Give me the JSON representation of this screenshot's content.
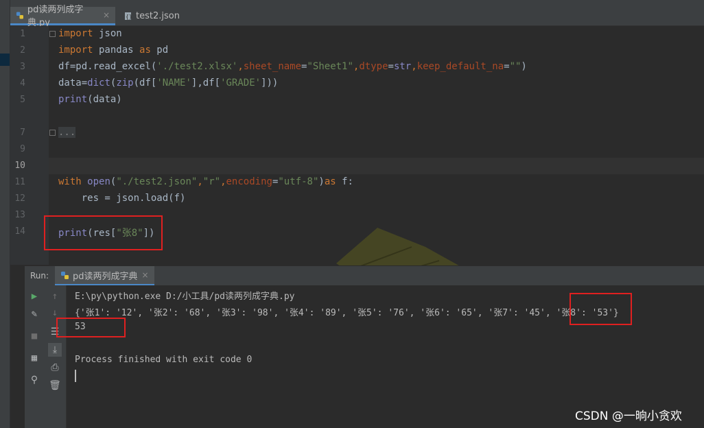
{
  "tabs": [
    {
      "label": "pd读两列成字典.py",
      "close": "×",
      "active": true
    },
    {
      "label": "test2.json",
      "active": false
    }
  ],
  "editor": {
    "line_numbers": [
      "1",
      "2",
      "3",
      "4",
      "5",
      "7",
      "9",
      "10",
      "11",
      "12",
      "13",
      "14"
    ],
    "lines": {
      "l1": {
        "kw": "import",
        "rest": " json"
      },
      "l2": {
        "kw": "import",
        "mid": " pandas ",
        "kw2": "as",
        "rest": " pd"
      },
      "l3": {
        "a": "df=pd.read_excel(",
        "s1": "'./test2.xlsx'",
        "c1": ",",
        "p1": "sheet_name",
        "e1": "=",
        "s2": "\"Sheet1\"",
        "c2": ",",
        "p2": "dtype",
        "e2": "=",
        "b1": "str",
        "c3": ",",
        "p3": "keep_default_na",
        "e3": "=",
        "s3": "\"\"",
        "z": ")"
      },
      "l4": {
        "a": "data=",
        "b1": "dict",
        "c": "(",
        "b2": "zip",
        "d": "(df[",
        "s1": "'NAME'",
        "e": "],df[",
        "s2": "'GRADE'",
        "f": "]))"
      },
      "l5": {
        "b1": "print",
        "rest": "(data)"
      },
      "l7": {
        "text": "..."
      },
      "l11": {
        "kw": "with",
        "sp": " ",
        "b1": "open",
        "a": "(",
        "s1": "\"./test2.json\"",
        "c1": ",",
        "s2": "\"r\"",
        "c2": ",",
        "p1": "encoding",
        "e1": "=",
        "s3": "\"utf-8\"",
        "b": ")",
        "kw2": "as",
        "rest": " f:"
      },
      "l12": {
        "text": "    res = json.load(f)"
      },
      "l14": {
        "b1": "print",
        "a": "(res[",
        "s1": "\"张8\"",
        "z": "])"
      }
    }
  },
  "run": {
    "label": "Run:",
    "tab_label": "pd读两列成字典",
    "tab_close": "×",
    "output": [
      "E:\\py\\python.exe D:/小工具/pd读两列成字典.py",
      "{'张1': '12', '张2': '68', '张3': '98', '张4': '89', '张5': '76', '张6': '65', '张7': '45', '张8': '53'}",
      "53",
      "",
      "Process finished with exit code 0"
    ]
  },
  "watermark": "CSDN @一晌小贪欢",
  "colors": {
    "keyword": "#cc7832",
    "string": "#6a8759",
    "builtin": "#8888c6",
    "param": "#aa4926",
    "highlight": "#e02020"
  }
}
